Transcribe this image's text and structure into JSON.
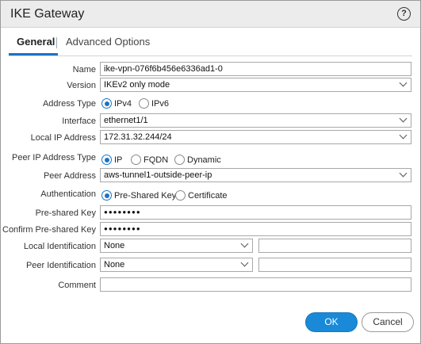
{
  "dialog": {
    "title": "IKE Gateway",
    "help_icon": "?"
  },
  "tabs": [
    {
      "label": "General",
      "active": true
    },
    {
      "label": "Advanced Options",
      "active": false
    }
  ],
  "form": {
    "name": {
      "label": "Name",
      "value": "ike-vpn-076f6b456e6336ad1-0"
    },
    "version": {
      "label": "Version",
      "value": "IKEv2 only mode"
    },
    "address_type": {
      "label": "Address Type",
      "options": [
        "IPv4",
        "IPv6"
      ],
      "selected": "IPv4"
    },
    "interface": {
      "label": "Interface",
      "value": "ethernet1/1"
    },
    "local_ip": {
      "label": "Local IP Address",
      "value": "172.31.32.244/24"
    },
    "peer_ip_type": {
      "label": "Peer IP Address Type",
      "options": [
        "IP",
        "FQDN",
        "Dynamic"
      ],
      "selected": "IP"
    },
    "peer_address": {
      "label": "Peer Address",
      "value": "aws-tunnel1-outside-peer-ip"
    },
    "authentication": {
      "label": "Authentication",
      "options": [
        "Pre-Shared Key",
        "Certificate"
      ],
      "selected": "Pre-Shared Key"
    },
    "psk": {
      "label": "Pre-shared Key",
      "value": "●●●●●●●●"
    },
    "confirm_psk": {
      "label": "Confirm Pre-shared Key",
      "value": "●●●●●●●●"
    },
    "local_id": {
      "label": "Local Identification",
      "value": "None",
      "extra_value": ""
    },
    "peer_id": {
      "label": "Peer Identification",
      "value": "None",
      "extra_value": ""
    },
    "comment": {
      "label": "Comment",
      "value": ""
    }
  },
  "buttons": {
    "ok": "OK",
    "cancel": "Cancel"
  },
  "colors": {
    "accent": "#1a73c8",
    "ok_button": "#1a8ad8",
    "titlebar": "#ececec"
  }
}
